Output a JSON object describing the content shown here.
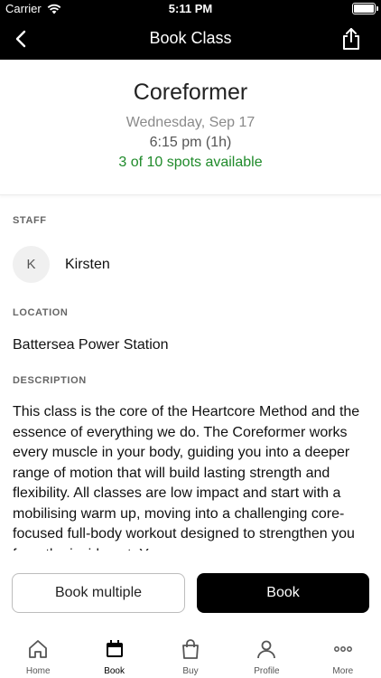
{
  "status_bar": {
    "carrier": "Carrier",
    "time": "5:11 PM"
  },
  "nav": {
    "title": "Book Class",
    "back_icon": "chevron-left-icon",
    "share_icon": "share-icon"
  },
  "class_info": {
    "name": "Coreformer",
    "date": "Wednesday, Sep 17",
    "time": "6:15 pm (1h)",
    "spots": "3 of 10 spots available",
    "spots_color": "#1f8a2a"
  },
  "staff": {
    "label": "STAFF",
    "initial": "K",
    "name": "Kirsten"
  },
  "location": {
    "label": "LOCATION",
    "value": "Battersea Power Station"
  },
  "description": {
    "label": "DESCRIPTION",
    "text": "This class is the core of the Heartcore Method and the essence of everything we do. The Coreformer works every muscle in your body, guiding you into a deeper range of motion that will build lasting strength and flexibility. All classes are low impact and start with a mobilising warm up, moving into a challenging core-focused full-body workout designed to strengthen you from the inside out. You"
  },
  "actions": {
    "book_multiple": "Book multiple",
    "book": "Book"
  },
  "tabs": [
    {
      "label": "Home",
      "icon": "home-icon"
    },
    {
      "label": "Book",
      "icon": "calendar-icon",
      "active": true
    },
    {
      "label": "Buy",
      "icon": "shopping-bag-icon"
    },
    {
      "label": "Profile",
      "icon": "person-icon"
    },
    {
      "label": "More",
      "icon": "more-dots-icon"
    }
  ]
}
